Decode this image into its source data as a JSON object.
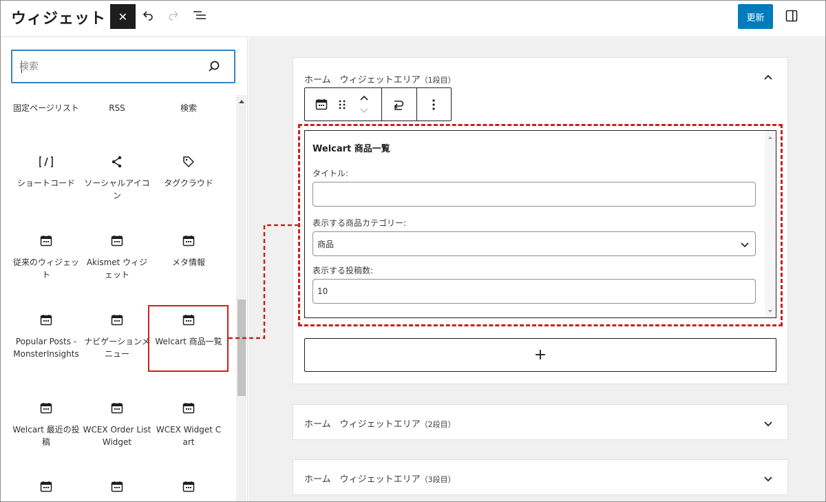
{
  "header": {
    "title": "ウィジェット",
    "close_label": "✕",
    "update_label": "更新",
    "icons": [
      "undo-icon",
      "redo-icon",
      "list-view-icon",
      "sidebar-toggle-icon"
    ]
  },
  "sidebar": {
    "search": {
      "placeholder": "検索",
      "icon": "search-icon"
    },
    "blocks": [
      {
        "label": "固定ページリスト",
        "icon": "none"
      },
      {
        "label": "RSS",
        "icon": "none"
      },
      {
        "label": "検索",
        "icon": "none"
      },
      {
        "label": "ショートコード",
        "icon": "shortcode-icon"
      },
      {
        "label": "ソーシャルアイコン",
        "icon": "share-icon"
      },
      {
        "label": "タグクラウド",
        "icon": "tag-icon"
      },
      {
        "label": "従来のウィジェット",
        "icon": "calendar-icon"
      },
      {
        "label": "Akismet ウィジェット",
        "icon": "calendar-icon"
      },
      {
        "label": "メタ情報",
        "icon": "calendar-icon"
      },
      {
        "label": "Popular Posts - MonsterInsights",
        "icon": "calendar-icon"
      },
      {
        "label": "ナビゲーションメニュー",
        "icon": "calendar-icon"
      },
      {
        "label": "Welcart 商品一覧",
        "icon": "calendar-icon"
      },
      {
        "label": "Welcart 最近の投稿",
        "icon": "calendar-icon"
      },
      {
        "label": "WCEX Order List Widget",
        "icon": "calendar-icon"
      },
      {
        "label": "WCEX Widget Cart",
        "icon": "calendar-icon"
      }
    ]
  },
  "main": {
    "areas": [
      {
        "title": "ホーム　ウィジェットエリア",
        "suffix": "（1段目）",
        "expanded": true
      },
      {
        "title": "ホーム　ウィジェットエリア",
        "suffix": "（2段目）",
        "expanded": false
      },
      {
        "title": "ホーム　ウィジェットエリア",
        "suffix": "（3段目）",
        "expanded": false
      }
    ],
    "widget": {
      "title": "Welcart 商品一覧",
      "title_label": "タイトル:",
      "title_value": "",
      "category_label": "表示する商品カテゴリー:",
      "category_value": "商品",
      "count_label": "表示する投稿数:",
      "count_value": "10"
    },
    "add_block_label": "+"
  },
  "colors": {
    "accent": "#007cba",
    "highlight": "#cc1f1f",
    "focus": "#3582c4",
    "dark": "#1e1e1e"
  }
}
